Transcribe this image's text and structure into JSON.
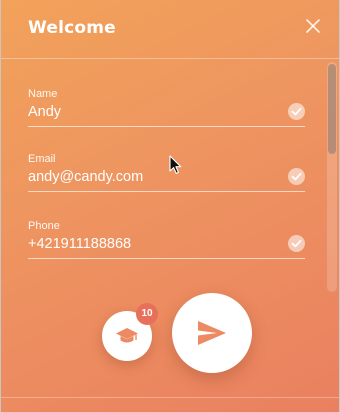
{
  "header": {
    "title": "Welcome",
    "close_icon": "close-icon"
  },
  "form": {
    "fields": [
      {
        "label": "Name",
        "value": "Andy",
        "status_icon": "check-circle-icon"
      },
      {
        "label": "Email",
        "value": "andy@candy.com",
        "status_icon": "check-circle-icon"
      },
      {
        "label": "Phone",
        "value": "+421911188868",
        "status_icon": "check-circle-icon"
      }
    ]
  },
  "actions": {
    "education_icon": "graduation-cap-icon",
    "badge_count": "10",
    "send_icon": "send-icon"
  },
  "colors": {
    "gradient_start": "#f2a25a",
    "gradient_end": "#ea8060",
    "accent": "#e8705a",
    "text": "#ffffff"
  }
}
